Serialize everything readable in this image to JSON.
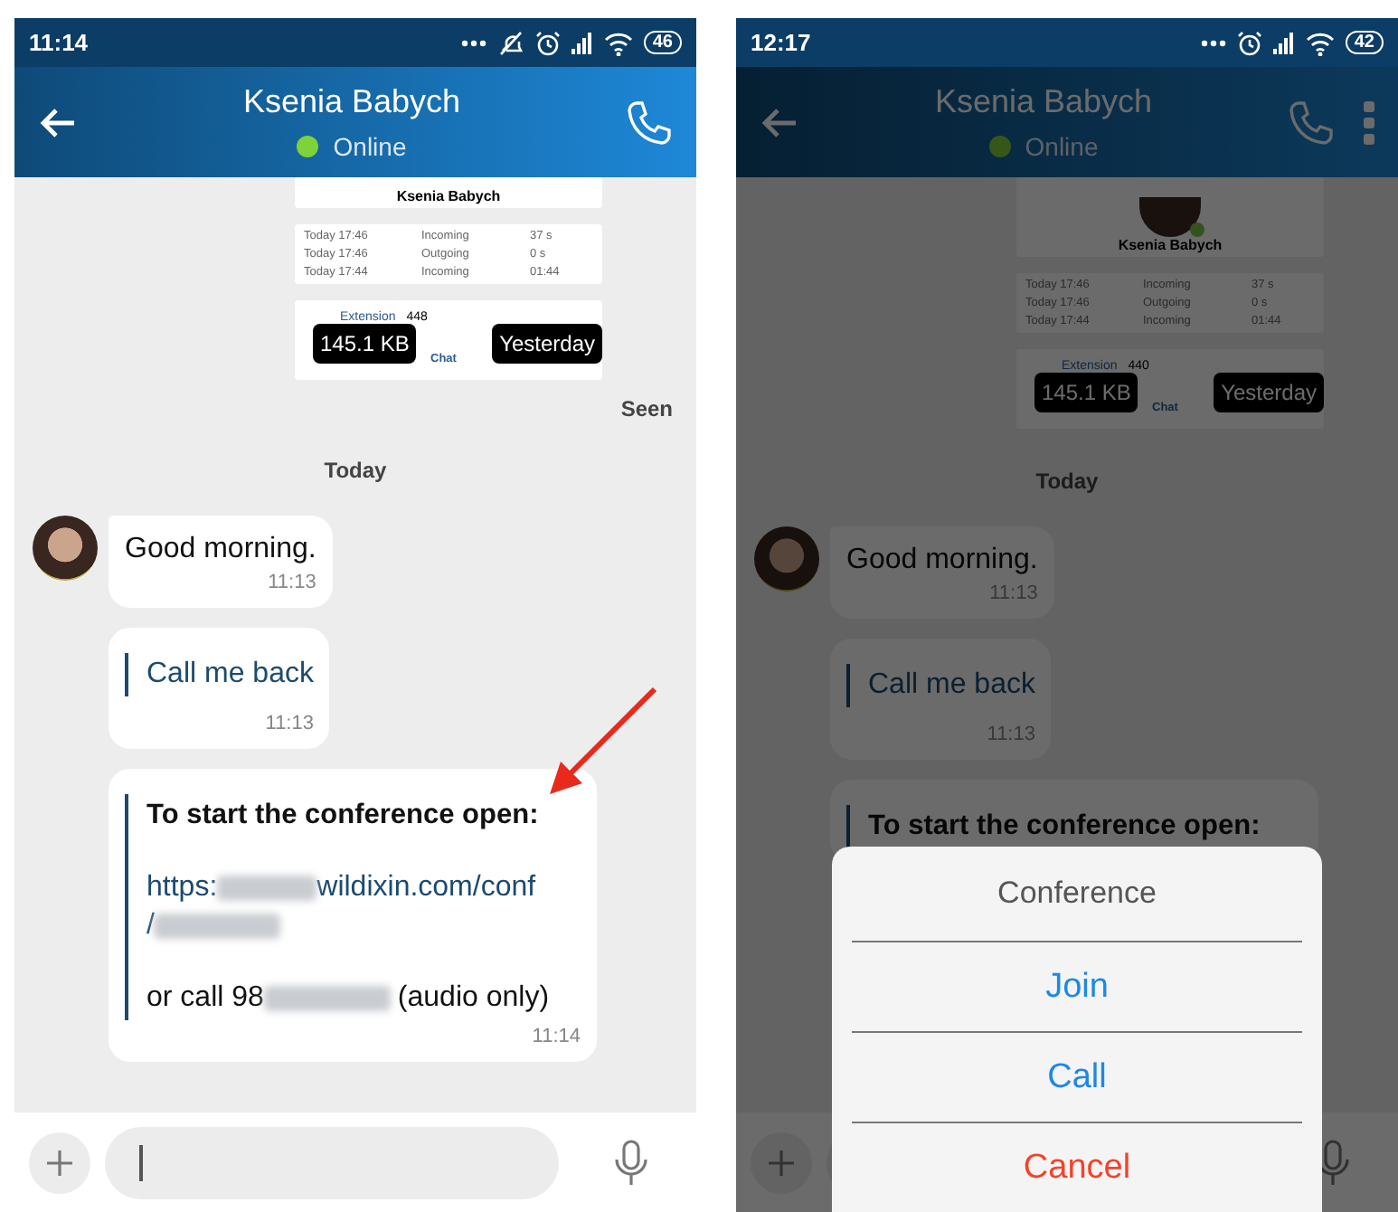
{
  "phones": [
    {
      "status_bar": {
        "time": "11:14",
        "do_not_disturb": true,
        "battery": "46"
      },
      "header": {
        "title": "Ksenia Babych",
        "status": "Online",
        "online": true,
        "menu": false
      },
      "dimmed": false,
      "shared_screenshot": {
        "avatar": false,
        "name": "Ksenia Babych",
        "calls": [
          {
            "date": "Today 17:46",
            "direction": "Incoming",
            "duration": "37 s"
          },
          {
            "date": "Today 17:46",
            "direction": "Outgoing",
            "duration": "0 s"
          },
          {
            "date": "Today 17:44",
            "direction": "Incoming",
            "duration": "01:44"
          }
        ],
        "extension_label": "Extension",
        "extension": "448",
        "chat": "Chat",
        "size_badge": "145.1 KB",
        "date_badge": "Yesterday"
      },
      "seen": "Seen",
      "date_divider": "Today",
      "messages": [
        {
          "kind": "text",
          "avatar": true,
          "text": "Good morning.",
          "time": "11:13"
        },
        {
          "kind": "quote",
          "text": "Call me back",
          "time": "11:13"
        },
        {
          "kind": "conference",
          "title": "To start the conference open:",
          "lines": [
            {
              "kind": "link",
              "segments": [
                {
                  "kind": "text",
                  "text": "https:"
                },
                {
                  "kind": "redacted"
                },
                {
                  "kind": "text",
                  "text": "wildixin.com/conf"
                }
              ]
            },
            {
              "kind": "link",
              "segments": [
                {
                  "kind": "text",
                  "text": "/"
                },
                {
                  "kind": "redacted"
                }
              ]
            },
            {
              "kind": "plain",
              "segments": [
                {
                  "kind": "text",
                  "text": "or call 98"
                },
                {
                  "kind": "redacted"
                },
                {
                  "kind": "text",
                  "text": "(audio only)"
                }
              ]
            }
          ],
          "time": "11:14"
        }
      ],
      "pointer_arrow": true
    },
    {
      "status_bar": {
        "time": "12:17",
        "do_not_disturb": false,
        "battery": "42"
      },
      "header": {
        "title": "Ksenia Babych",
        "status": "Online",
        "online": true,
        "menu": true
      },
      "dimmed": true,
      "shared_screenshot": {
        "avatar": true,
        "name": "Ksenia Babych",
        "calls": [
          {
            "date": "Today 17:46",
            "direction": "Incoming",
            "duration": "37 s"
          },
          {
            "date": "Today 17:46",
            "direction": "Outgoing",
            "duration": "0 s"
          },
          {
            "date": "Today 17:44",
            "direction": "Incoming",
            "duration": "01:44"
          }
        ],
        "extension_label": "Extension",
        "extension": "440",
        "chat": "Chat",
        "size_badge": "145.1 KB",
        "date_badge": "Yesterday"
      },
      "date_divider": "Today",
      "messages": [
        {
          "kind": "text",
          "avatar": true,
          "text": "Good morning.",
          "time": "11:13"
        },
        {
          "kind": "quote",
          "text": "Call me back",
          "time": "11:13"
        },
        {
          "kind": "conference",
          "title": "To start the conference open:"
        }
      ],
      "pointer_arrow": false,
      "action_sheet": {
        "title": "Conference",
        "actions": [
          {
            "label": "Join",
            "kind": "default"
          },
          {
            "label": "Call",
            "kind": "default"
          },
          {
            "label": "Cancel",
            "kind": "destructive"
          }
        ]
      }
    }
  ]
}
